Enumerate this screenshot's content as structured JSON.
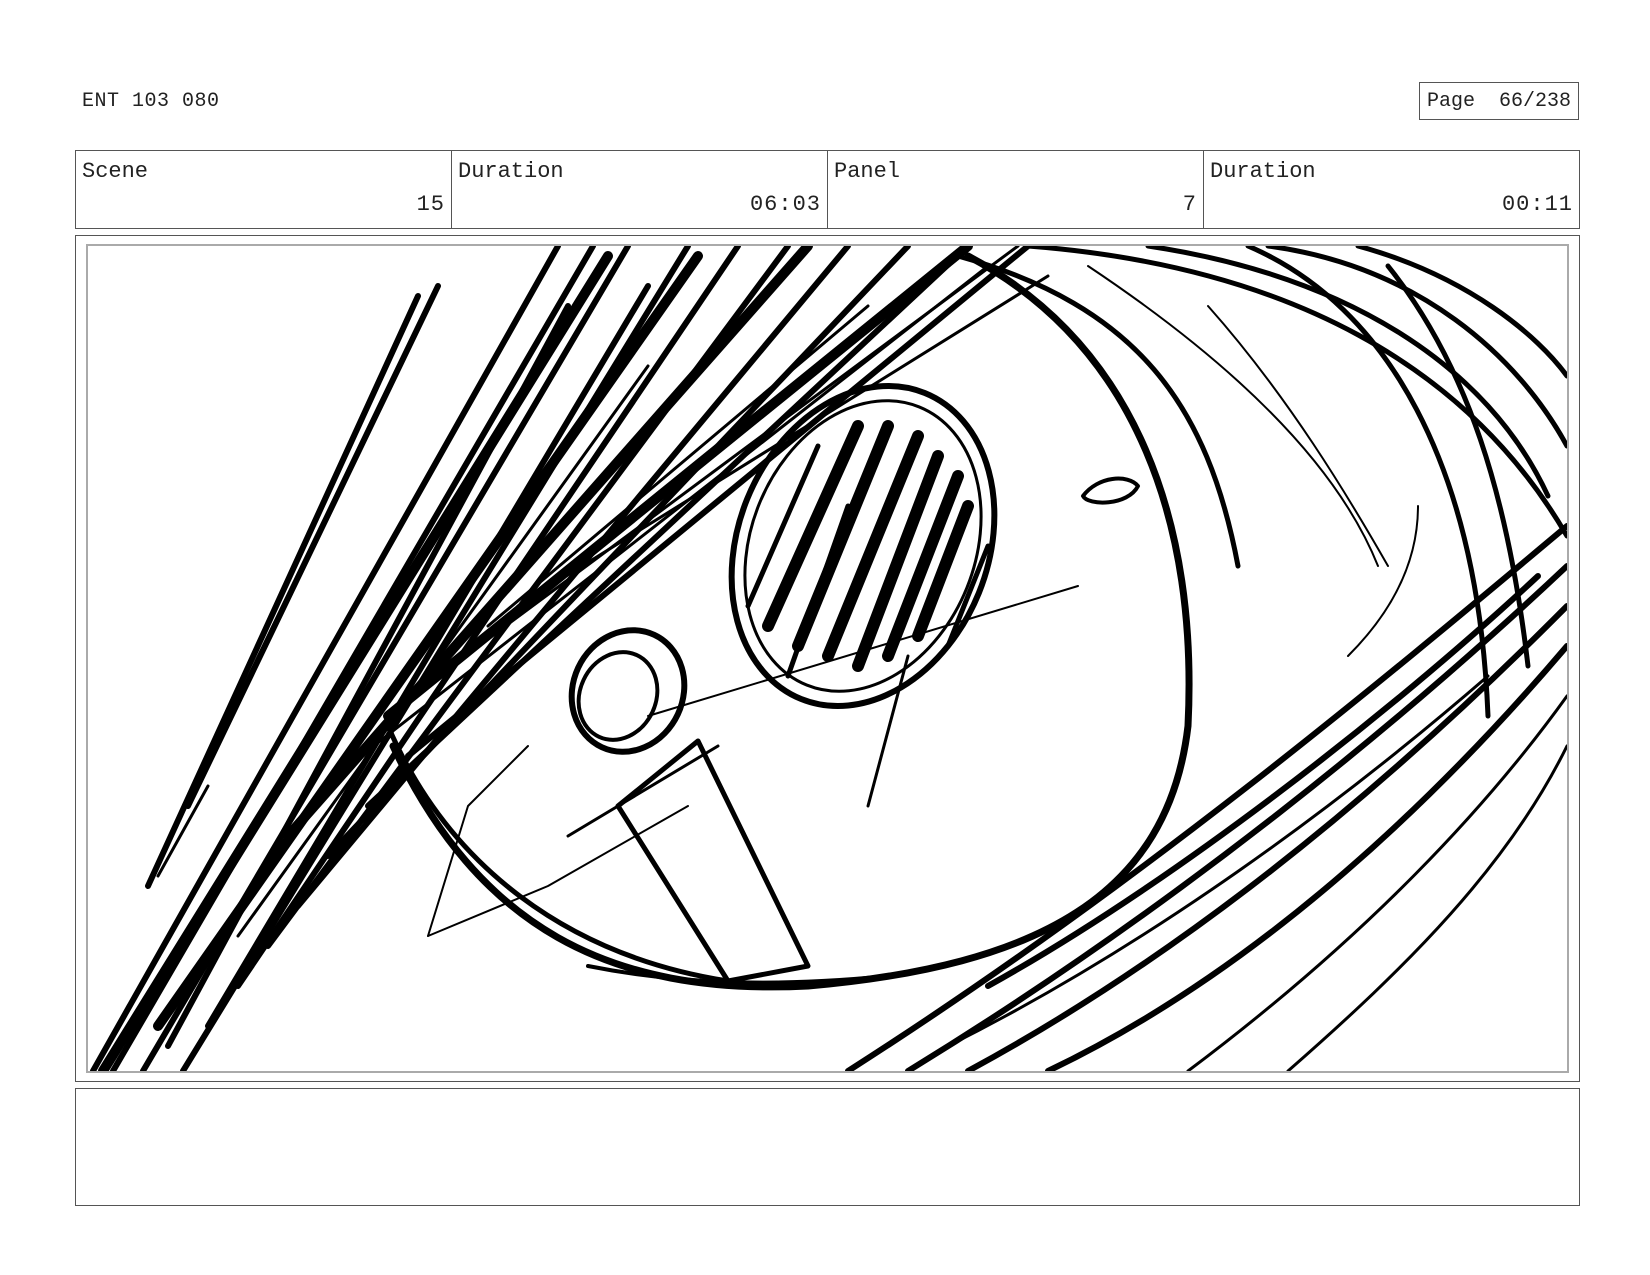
{
  "header": {
    "production_id": "ENT 103 080",
    "page_label": "Page",
    "page_value": "66/238"
  },
  "info": {
    "scene_label": "Scene",
    "scene_value": "15",
    "scene_duration_label": "Duration",
    "scene_duration_value": "06:03",
    "panel_label": "Panel",
    "panel_value": "7",
    "panel_duration_label": "Duration",
    "panel_duration_value": "00:11"
  },
  "notes": {
    "text": ""
  }
}
